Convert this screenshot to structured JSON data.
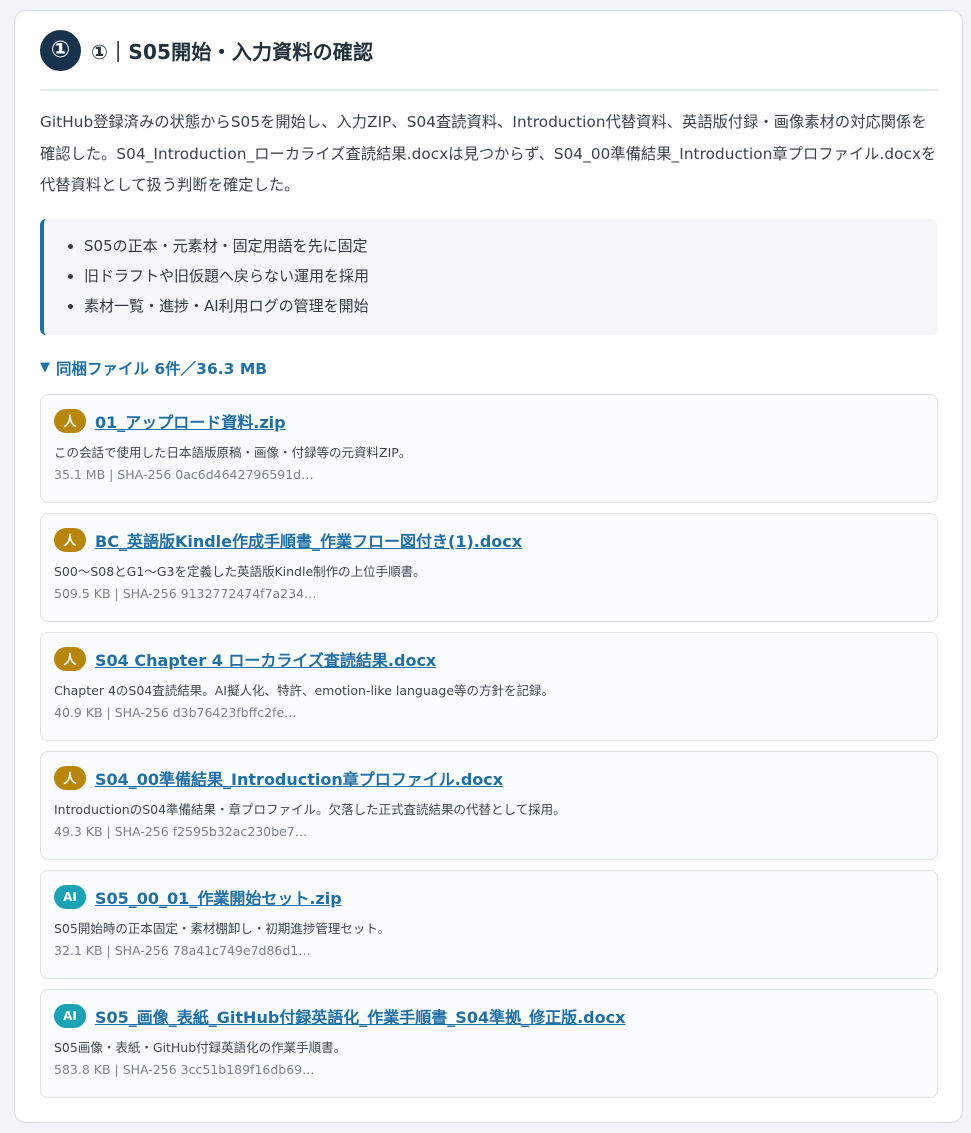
{
  "step": {
    "number": "①",
    "title": "①｜S05開始・入力資料の確認"
  },
  "summary": "GitHub登録済みの状態からS05を開始し、入力ZIP、S04査読資料、Introduction代替資料、英語版付録・画像素材の対応関係を確認した。S04_Introduction_ローカライズ査読結果.docxは見つからず、S04_00準備結果_Introduction章プロファイル.docxを代替資料として扱う判断を確定した。",
  "notes": [
    "S05の正本・元素材・固定用語を先に固定",
    "旧ドラフトや旧仮題へ戻らない運用を採用",
    "素材一覧・進捗・AI利用ログの管理を開始"
  ],
  "files_summary": {
    "triangle": "▼",
    "label": "同梱ファイル 6件／36.3 MB"
  },
  "files": [
    {
      "badge": "人",
      "badge_type": "human",
      "name": "01_アップロード資料.zip",
      "description": "この会話で使用した日本語版原稿・画像・付録等の元資料ZIP。",
      "meta": "35.1 MB | SHA-256 0ac6d4642796591d…"
    },
    {
      "badge": "人",
      "badge_type": "human",
      "name": "BC_英語版Kindle作成手順書_作業フロー図付き(1).docx",
      "description": "S00〜S08とG1〜G3を定義した英語版Kindle制作の上位手順書。",
      "meta": "509.5 KB | SHA-256 9132772474f7a234…"
    },
    {
      "badge": "人",
      "badge_type": "human",
      "name": "S04 Chapter 4 ローカライズ査読結果.docx",
      "description": "Chapter 4のS04査読結果。AI擬人化、特許、emotion-like language等の方針を記録。",
      "meta": "40.9 KB | SHA-256 d3b76423fbffc2fe…"
    },
    {
      "badge": "人",
      "badge_type": "human",
      "name": "S04_00準備結果_Introduction章プロファイル.docx",
      "description": "IntroductionのS04準備結果・章プロファイル。欠落した正式査読結果の代替として採用。",
      "meta": "49.3 KB | SHA-256 f2595b32ac230be7…"
    },
    {
      "badge": "AI",
      "badge_type": "ai",
      "name": "S05_00_01_作業開始セット.zip",
      "description": "S05開始時の正本固定・素材棚卸し・初期進捗管理セット。",
      "meta": "32.1 KB | SHA-256 78a41c749e7d86d1…"
    },
    {
      "badge": "AI",
      "badge_type": "ai",
      "name": "S05_画像_表紙_GitHub付録英語化_作業手順書_S04準拠_修正版.docx",
      "description": "S05画像・表紙・GitHub付録英語化の作業手順書。",
      "meta": "583.8 KB | SHA-256 3cc51b189f16db69…"
    }
  ]
}
